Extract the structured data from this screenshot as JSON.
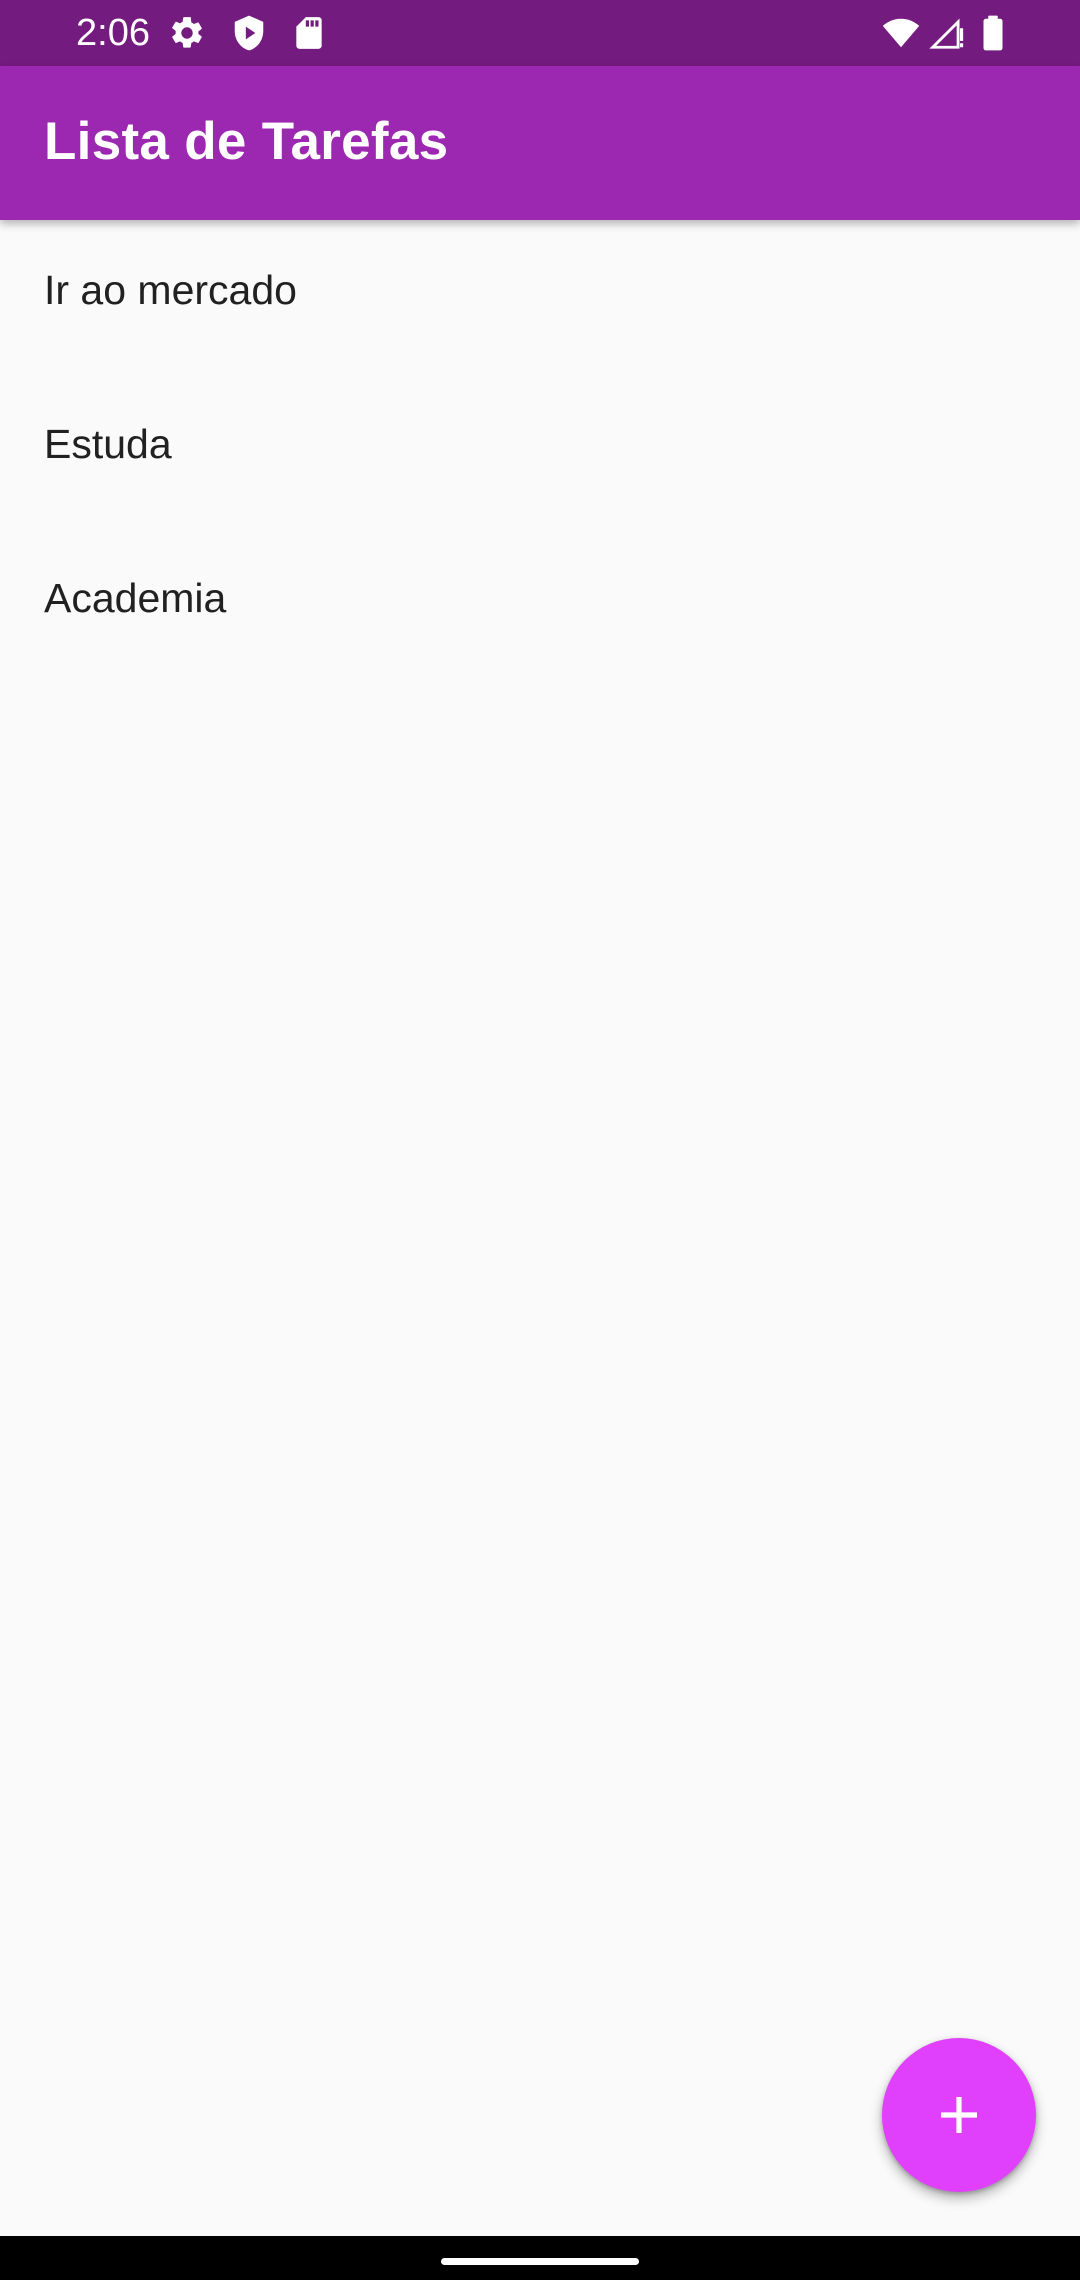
{
  "status_bar": {
    "time": "2:06",
    "icons": [
      "settings-icon",
      "play-protect-icon",
      "sd-card-icon",
      "wifi-icon",
      "signal-icon",
      "battery-icon"
    ],
    "background_color": "#741b80"
  },
  "app_bar": {
    "title": "Lista de Tarefas",
    "background_color": "#9c27b0"
  },
  "tasks": [
    {
      "label": "Ir ao mercado"
    },
    {
      "label": "Estuda"
    },
    {
      "label": "Academia"
    }
  ],
  "fab": {
    "icon": "add-icon",
    "background_color": "#e040fb"
  }
}
